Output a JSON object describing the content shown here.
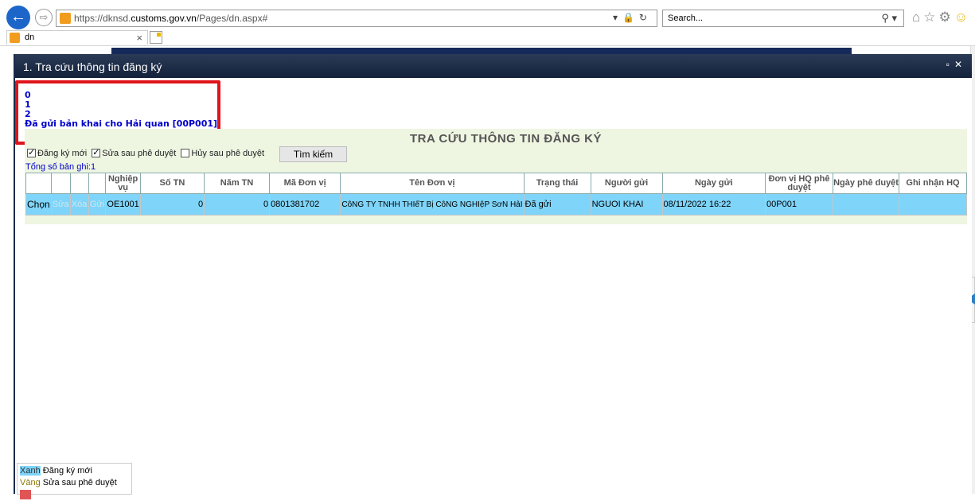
{
  "browser": {
    "url_prefix": "https://dknsd.",
    "url_domain": "customs.gov.vn",
    "url_path": "/Pages/dn.aspx#",
    "search_placeholder": "Search...",
    "tab_label": "dn"
  },
  "dialog": {
    "title": "1. Tra cứu thông tin đăng ký"
  },
  "messages": [
    "0",
    "1",
    "2",
    "Đã gửi bản khai cho Hải quan [00P001]."
  ],
  "panel": {
    "title": "TRA CỨU THÔNG TIN ĐĂNG KÝ",
    "filters": [
      {
        "label": "Đăng ký mới",
        "checked": true
      },
      {
        "label": "Sửa sau phê duyệt",
        "checked": true
      },
      {
        "label": "Hủy sau phê duyệt",
        "checked": false
      }
    ],
    "search_button": "Tìm kiếm",
    "total_label": "Tổng số bản ghi:1"
  },
  "table": {
    "headers": [
      "Nghiệp vụ",
      "Số TN",
      "Năm TN",
      "Mã Đơn vị",
      "Tên Đơn vị",
      "Trạng thái",
      "Người gửi",
      "Ngày gửi",
      "Đơn vị HQ phê duyệt",
      "Ngày phê duyệt",
      "Ghi nhận HQ"
    ],
    "row": {
      "actions": [
        "Chọn",
        "Sửa",
        "Xóa",
        "Gửi"
      ],
      "nghiep_vu": "OE1001",
      "so_tn": "0",
      "nam_tn": "0",
      "ma_don_vi": "0801381702",
      "ten_don_vi": "CôNG TY TNHH THIếT Bị CôNG NGHIệP SơN HảI",
      "trang_thai": "Đã gửi",
      "nguoi_gui": "NGUOI KHAI",
      "ngay_gui": "08/11/2022 16:22",
      "don_vi_hq": "00P001",
      "ngay_phe_duyet": "",
      "ghi_nhan_hq": ""
    }
  },
  "legend": [
    {
      "swatch": "Xanh",
      "text": "Đăng ký mới",
      "color": "#7fd4f9"
    },
    {
      "swatch": "Vàng",
      "text": "Sửa sau phê duyệt",
      "color": "#8a7700"
    }
  ]
}
